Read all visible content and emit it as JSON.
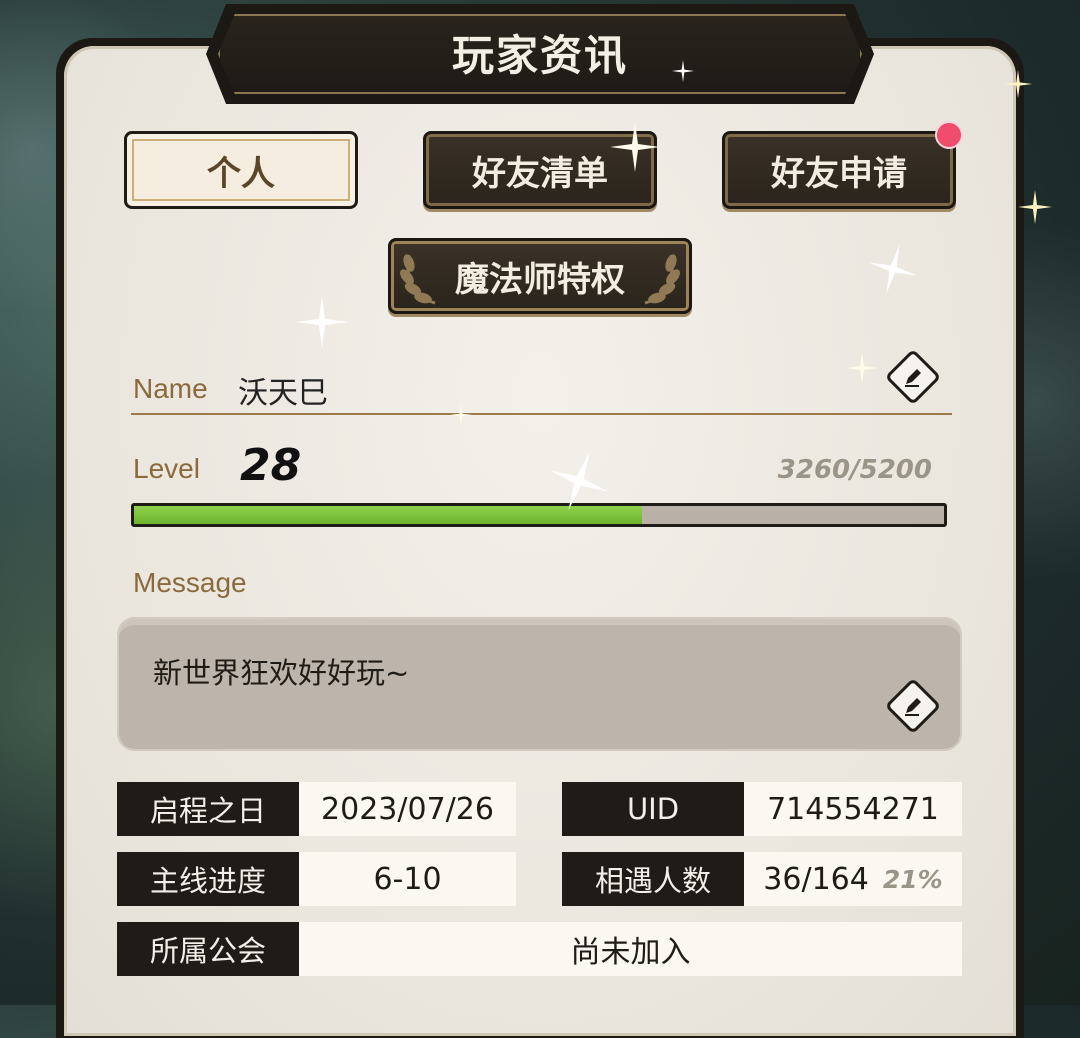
{
  "title": "玩家资讯",
  "tabs": {
    "personal": "个人",
    "friend_list": "好友清单",
    "friend_requests": "好友申请",
    "mage_privilege": "魔法师特权"
  },
  "badges": {
    "friend_requests_has_new": true,
    "dot_color": "#ef4d6b"
  },
  "profile": {
    "name_label": "Name",
    "name_value": "沃天巳",
    "level_label": "Level",
    "level_value": "28",
    "exp_text": "3260/5200",
    "exp_progress": 0.627,
    "message_label": "Message",
    "message_value": "新世界狂欢好好玩~"
  },
  "info": {
    "start_date_label": "启程之日",
    "start_date_value": "2023/07/26",
    "uid_label": "UID",
    "uid_value": "714554271",
    "story_progress_label": "主线进度",
    "story_progress_value": "6-10",
    "encountered_label": "相遇人数",
    "encountered_value": "36/164",
    "encountered_percent": "21%",
    "guild_label": "所属公会",
    "guild_value": "尚未加入"
  },
  "colors": {
    "accent_gold": "#8a6a3c",
    "exp_green": "#7cc23c",
    "dark_plate": "#1f1b16"
  },
  "icons": [
    "edit-icon",
    "laurel-icon",
    "sparkle-icon"
  ]
}
